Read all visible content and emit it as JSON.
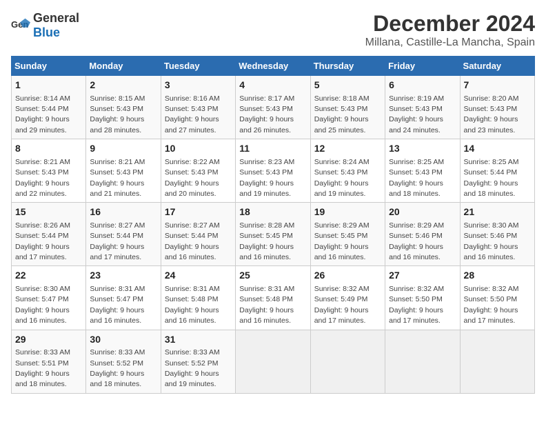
{
  "logo": {
    "general": "General",
    "blue": "Blue"
  },
  "title": "December 2024",
  "subtitle": "Millana, Castille-La Mancha, Spain",
  "days_header": [
    "Sunday",
    "Monday",
    "Tuesday",
    "Wednesday",
    "Thursday",
    "Friday",
    "Saturday"
  ],
  "weeks": [
    [
      {
        "day": "1",
        "sunrise": "8:14 AM",
        "sunset": "5:44 PM",
        "daylight": "9 hours and 29 minutes."
      },
      {
        "day": "2",
        "sunrise": "8:15 AM",
        "sunset": "5:43 PM",
        "daylight": "9 hours and 28 minutes."
      },
      {
        "day": "3",
        "sunrise": "8:16 AM",
        "sunset": "5:43 PM",
        "daylight": "9 hours and 27 minutes."
      },
      {
        "day": "4",
        "sunrise": "8:17 AM",
        "sunset": "5:43 PM",
        "daylight": "9 hours and 26 minutes."
      },
      {
        "day": "5",
        "sunrise": "8:18 AM",
        "sunset": "5:43 PM",
        "daylight": "9 hours and 25 minutes."
      },
      {
        "day": "6",
        "sunrise": "8:19 AM",
        "sunset": "5:43 PM",
        "daylight": "9 hours and 24 minutes."
      },
      {
        "day": "7",
        "sunrise": "8:20 AM",
        "sunset": "5:43 PM",
        "daylight": "9 hours and 23 minutes."
      }
    ],
    [
      {
        "day": "8",
        "sunrise": "8:21 AM",
        "sunset": "5:43 PM",
        "daylight": "9 hours and 22 minutes."
      },
      {
        "day": "9",
        "sunrise": "8:21 AM",
        "sunset": "5:43 PM",
        "daylight": "9 hours and 21 minutes."
      },
      {
        "day": "10",
        "sunrise": "8:22 AM",
        "sunset": "5:43 PM",
        "daylight": "9 hours and 20 minutes."
      },
      {
        "day": "11",
        "sunrise": "8:23 AM",
        "sunset": "5:43 PM",
        "daylight": "9 hours and 19 minutes."
      },
      {
        "day": "12",
        "sunrise": "8:24 AM",
        "sunset": "5:43 PM",
        "daylight": "9 hours and 19 minutes."
      },
      {
        "day": "13",
        "sunrise": "8:25 AM",
        "sunset": "5:43 PM",
        "daylight": "9 hours and 18 minutes."
      },
      {
        "day": "14",
        "sunrise": "8:25 AM",
        "sunset": "5:44 PM",
        "daylight": "9 hours and 18 minutes."
      }
    ],
    [
      {
        "day": "15",
        "sunrise": "8:26 AM",
        "sunset": "5:44 PM",
        "daylight": "9 hours and 17 minutes."
      },
      {
        "day": "16",
        "sunrise": "8:27 AM",
        "sunset": "5:44 PM",
        "daylight": "9 hours and 17 minutes."
      },
      {
        "day": "17",
        "sunrise": "8:27 AM",
        "sunset": "5:44 PM",
        "daylight": "9 hours and 16 minutes."
      },
      {
        "day": "18",
        "sunrise": "8:28 AM",
        "sunset": "5:45 PM",
        "daylight": "9 hours and 16 minutes."
      },
      {
        "day": "19",
        "sunrise": "8:29 AM",
        "sunset": "5:45 PM",
        "daylight": "9 hours and 16 minutes."
      },
      {
        "day": "20",
        "sunrise": "8:29 AM",
        "sunset": "5:46 PM",
        "daylight": "9 hours and 16 minutes."
      },
      {
        "day": "21",
        "sunrise": "8:30 AM",
        "sunset": "5:46 PM",
        "daylight": "9 hours and 16 minutes."
      }
    ],
    [
      {
        "day": "22",
        "sunrise": "8:30 AM",
        "sunset": "5:47 PM",
        "daylight": "9 hours and 16 minutes."
      },
      {
        "day": "23",
        "sunrise": "8:31 AM",
        "sunset": "5:47 PM",
        "daylight": "9 hours and 16 minutes."
      },
      {
        "day": "24",
        "sunrise": "8:31 AM",
        "sunset": "5:48 PM",
        "daylight": "9 hours and 16 minutes."
      },
      {
        "day": "25",
        "sunrise": "8:31 AM",
        "sunset": "5:48 PM",
        "daylight": "9 hours and 16 minutes."
      },
      {
        "day": "26",
        "sunrise": "8:32 AM",
        "sunset": "5:49 PM",
        "daylight": "9 hours and 17 minutes."
      },
      {
        "day": "27",
        "sunrise": "8:32 AM",
        "sunset": "5:50 PM",
        "daylight": "9 hours and 17 minutes."
      },
      {
        "day": "28",
        "sunrise": "8:32 AM",
        "sunset": "5:50 PM",
        "daylight": "9 hours and 17 minutes."
      }
    ],
    [
      {
        "day": "29",
        "sunrise": "8:33 AM",
        "sunset": "5:51 PM",
        "daylight": "9 hours and 18 minutes."
      },
      {
        "day": "30",
        "sunrise": "8:33 AM",
        "sunset": "5:52 PM",
        "daylight": "9 hours and 18 minutes."
      },
      {
        "day": "31",
        "sunrise": "8:33 AM",
        "sunset": "5:52 PM",
        "daylight": "9 hours and 19 minutes."
      },
      null,
      null,
      null,
      null
    ]
  ],
  "labels": {
    "sunrise": "Sunrise:",
    "sunset": "Sunset:",
    "daylight": "Daylight:"
  }
}
